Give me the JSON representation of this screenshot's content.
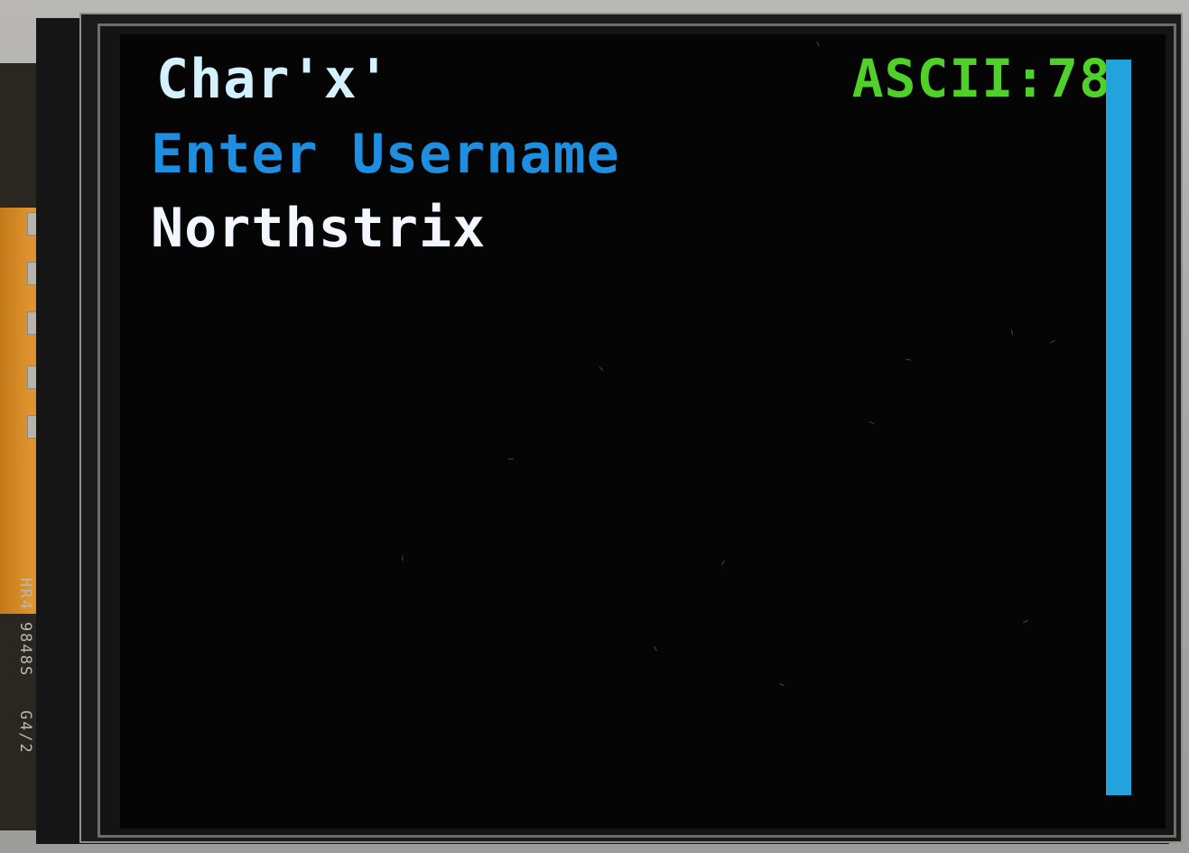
{
  "panel": {
    "marking": "HR4 9848S   G4/2"
  },
  "screen": {
    "char_label": "Char'x'",
    "ascii_label": "ASCII:78",
    "prompt": "Enter Username",
    "username_value": "Northstrix"
  },
  "colors": {
    "char_text": "#d4f1ff",
    "ascii_text": "#4fd12a",
    "prompt_text": "#1e8ee0",
    "username_text": "#f2f6ff",
    "scroll_bar": "#22a3dc",
    "screen_bg": "#050505"
  }
}
